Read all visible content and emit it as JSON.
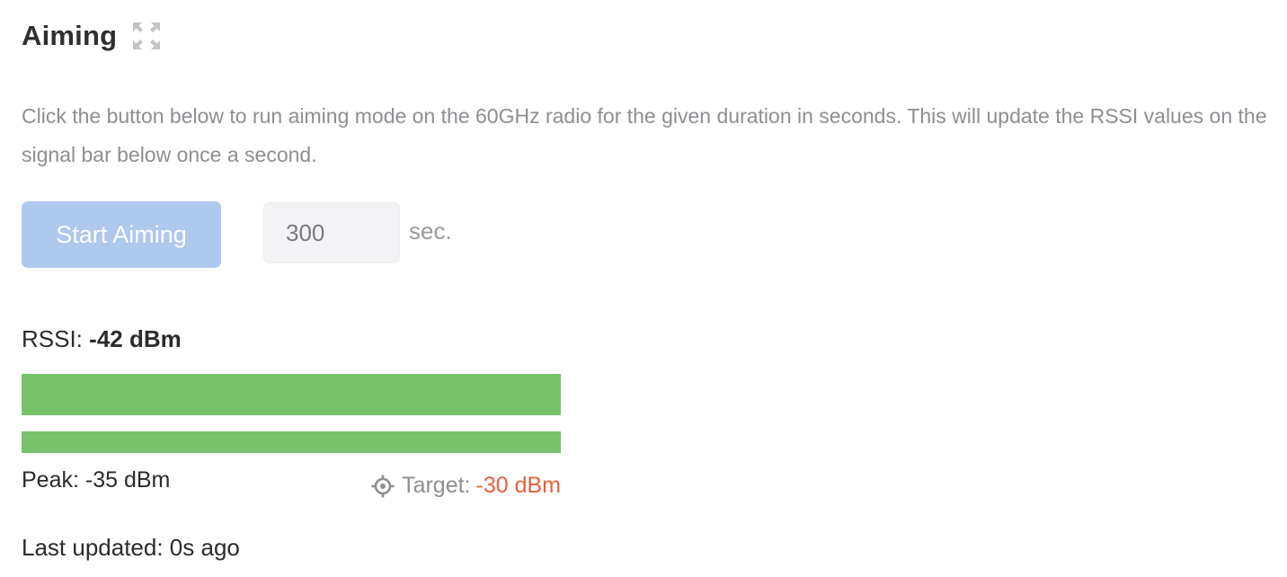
{
  "header": {
    "title": "Aiming",
    "expand_icon": "expand-icon"
  },
  "description": "Click the button below to run aiming mode on the 60GHz radio for the given duration in seconds. This will update the RSSI values on the signal bar below once a second.",
  "controls": {
    "start_label": "Start Aiming",
    "duration_value": "300",
    "duration_unit": "sec."
  },
  "signal": {
    "rssi_label": "RSSI:",
    "rssi_value": "-42 dBm",
    "rssi_fill_fraction": 1.0,
    "peak_fill_fraction": 1.0,
    "peak_label": "Peak: -35 dBm",
    "target_icon": "crosshair-icon",
    "target_label": "Target:",
    "target_value": "-30 dBm",
    "last_updated": "Last updated: 0s ago"
  },
  "colors": {
    "bar_fill": "#78c26b",
    "target_value": "#e8603c",
    "button_disabled": "#aec8ee"
  }
}
